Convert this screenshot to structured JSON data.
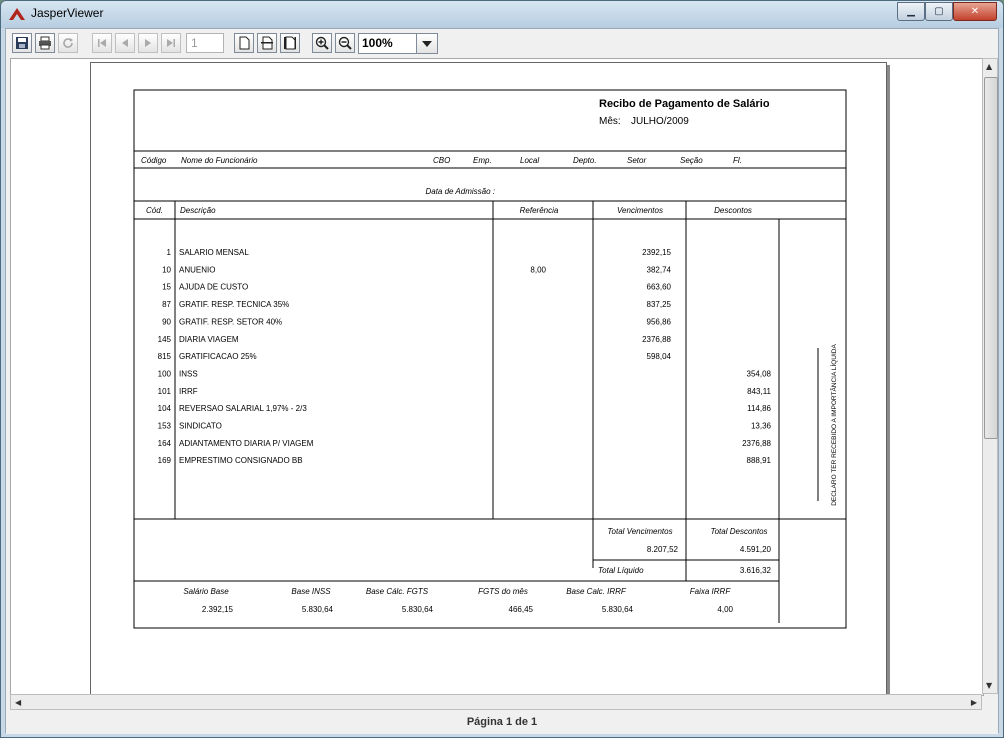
{
  "window": {
    "title": "JasperViewer"
  },
  "toolbar": {
    "page_number": "1",
    "zoom": "100%"
  },
  "status": {
    "page_label": "Página 1 de 1"
  },
  "report": {
    "title": "Recibo de Pagamento de Salário",
    "month_label": "Mês:",
    "month_value": "JULHO/2009",
    "employee_headers": [
      "Código",
      "Nome do Funcionário",
      "CBO",
      "Emp.",
      "Local",
      "Depto.",
      "Setor",
      "Seção",
      "Fl."
    ],
    "admission_label": "Data de Admissão :",
    "table_headers": {
      "code": "Cód.",
      "description": "Descrição",
      "reference": "Referência",
      "earnings": "Vencimentos",
      "deductions": "Descontos"
    },
    "items": [
      {
        "code": "1",
        "description": "SALARIO MENSAL",
        "reference": "",
        "earning": "2392,15",
        "deduction": ""
      },
      {
        "code": "10",
        "description": "ANUENIO",
        "reference": "8,00",
        "earning": "382,74",
        "deduction": ""
      },
      {
        "code": "15",
        "description": "AJUDA DE CUSTO",
        "reference": "",
        "earning": "663,60",
        "deduction": ""
      },
      {
        "code": "87",
        "description": "GRATIF. RESP. TECNICA 35%",
        "reference": "",
        "earning": "837,25",
        "deduction": ""
      },
      {
        "code": "90",
        "description": "GRATIF. RESP. SETOR 40%",
        "reference": "",
        "earning": "956,86",
        "deduction": ""
      },
      {
        "code": "145",
        "description": "DIARIA VIAGEM",
        "reference": "",
        "earning": "2376,88",
        "deduction": ""
      },
      {
        "code": "815",
        "description": "GRATIFICACAO 25%",
        "reference": "",
        "earning": "598,04",
        "deduction": ""
      },
      {
        "code": "100",
        "description": "INSS",
        "reference": "",
        "earning": "",
        "deduction": "354,08"
      },
      {
        "code": "101",
        "description": "IRRF",
        "reference": "",
        "earning": "",
        "deduction": "843,11"
      },
      {
        "code": "104",
        "description": "REVERSAO SALARIAL 1,97% - 2/3",
        "reference": "",
        "earning": "",
        "deduction": "114,86"
      },
      {
        "code": "153",
        "description": "SINDICATO",
        "reference": "",
        "earning": "",
        "deduction": "13,36"
      },
      {
        "code": "164",
        "description": "ADIANTAMENTO DIARIA P/ VIAGEM",
        "reference": "",
        "earning": "",
        "deduction": "2376,88"
      },
      {
        "code": "169",
        "description": "EMPRESTIMO CONSIGNADO BB",
        "reference": "",
        "earning": "",
        "deduction": "888,91"
      }
    ],
    "declaration": "DECLARO TER RECEBIDO A IMPORTÂNCIA LÍQUIDA",
    "totals": {
      "earnings_label": "Total Vencimentos",
      "earnings_value": "8.207,52",
      "deductions_label": "Total Descontos",
      "deductions_value": "4.591,20",
      "net_label": "Total Líquido",
      "net_value": "3.616,32"
    },
    "bases": [
      {
        "label": "Salário Base",
        "value": "2.392,15"
      },
      {
        "label": "Base INSS",
        "value": "5.830,64"
      },
      {
        "label": "Base Cálc. FGTS",
        "value": "5.830,64"
      },
      {
        "label": "FGTS do mês",
        "value": "466,45"
      },
      {
        "label": "Base Calc. IRRF",
        "value": "5.830,64"
      },
      {
        "label": "Faixa IRRF",
        "value": "4,00"
      }
    ]
  }
}
